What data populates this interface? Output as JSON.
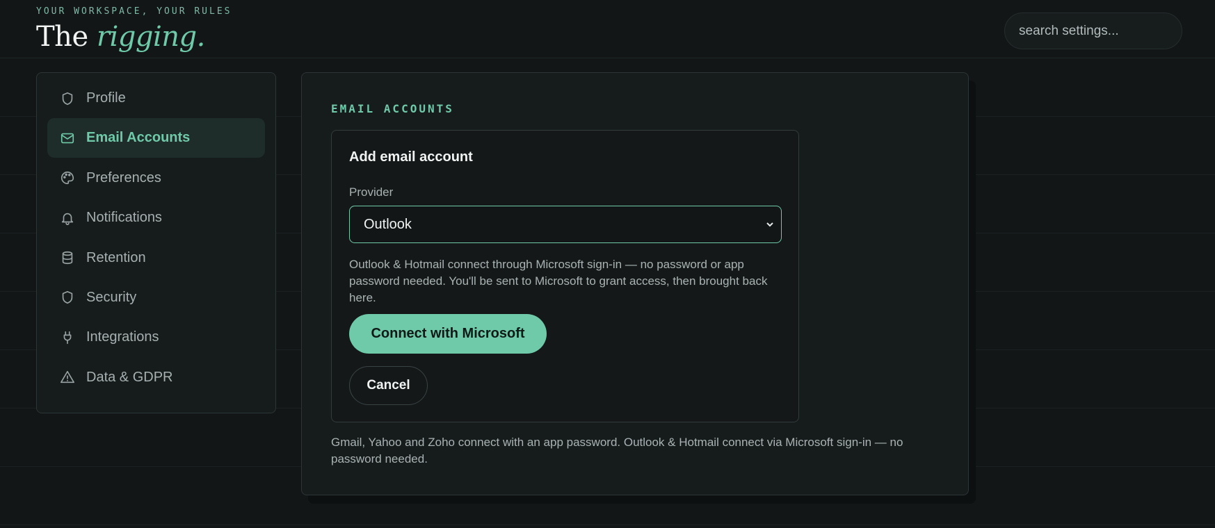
{
  "header": {
    "tagline": "YOUR WORKSPACE, YOUR RULES",
    "brand_plain": "The",
    "brand_accent": "rigging.",
    "search_placeholder": "search settings..."
  },
  "sidebar": {
    "items": [
      {
        "label": "Profile",
        "icon": "shield-icon",
        "active": false
      },
      {
        "label": "Email Accounts",
        "icon": "mail-icon",
        "active": true
      },
      {
        "label": "Preferences",
        "icon": "palette-icon",
        "active": false
      },
      {
        "label": "Notifications",
        "icon": "bell-icon",
        "active": false
      },
      {
        "label": "Retention",
        "icon": "database-icon",
        "active": false
      },
      {
        "label": "Security",
        "icon": "shield-icon",
        "active": false
      },
      {
        "label": "Integrations",
        "icon": "plug-icon",
        "active": false
      },
      {
        "label": "Data & GDPR",
        "icon": "warning-icon",
        "active": false
      }
    ]
  },
  "main": {
    "section_title": "EMAIL ACCOUNTS",
    "card": {
      "title": "Add email account",
      "provider_label": "Provider",
      "provider_value": "Outlook",
      "hint": "Outlook & Hotmail connect through Microsoft sign-in — no password or app password needed. You'll be sent to Microsoft to grant access, then brought back here.",
      "connect_label": "Connect with Microsoft",
      "cancel_label": "Cancel"
    },
    "footnote": "Gmail, Yahoo and Zoho connect with an app password. Outlook & Hotmail connect via Microsoft sign-in — no password needed."
  },
  "colors": {
    "accent": "#6fcaa9",
    "background": "#121617",
    "panel": "#161b1c"
  }
}
